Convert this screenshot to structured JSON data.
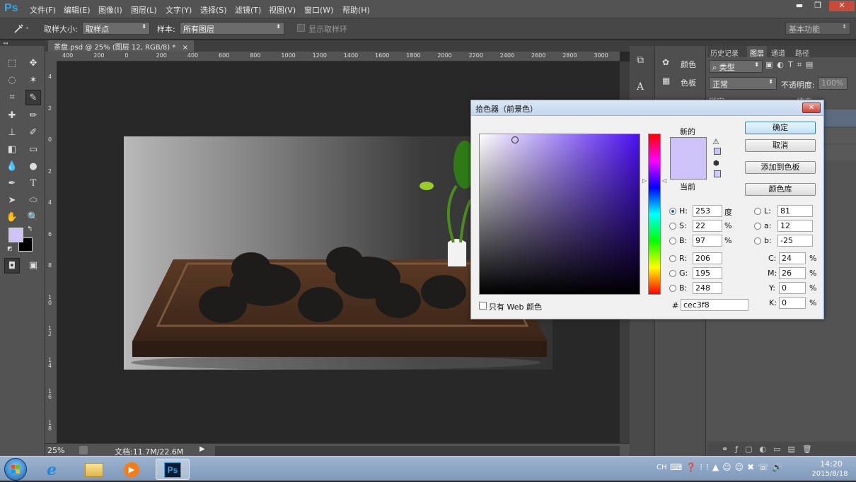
{
  "app": {
    "logo": "Ps"
  },
  "menubar": {
    "items": [
      "文件(F)",
      "编辑(E)",
      "图像(I)",
      "图层(L)",
      "文字(Y)",
      "选择(S)",
      "滤镜(T)",
      "视图(V)",
      "窗口(W)",
      "帮助(H)"
    ],
    "win_minimize": "▬",
    "win_restore": "❐",
    "win_close": "✕"
  },
  "options": {
    "sample_size_label": "取样大小:",
    "sample_size_value": "取样点",
    "sample_label": "样本:",
    "sample_value": "所有图层",
    "show_ring_label": "显示取样环",
    "workspace": "基本功能"
  },
  "document": {
    "tab_title": "茶盘.psd @ 25% (图层 12, RGB/8) *",
    "tab_close": "×",
    "ruler_h": [
      "400",
      "200",
      "0",
      "200",
      "400",
      "600",
      "800",
      "1000",
      "1200",
      "1400",
      "1600",
      "1800",
      "2000",
      "2200",
      "2400",
      "2600",
      "2800",
      "3000"
    ],
    "ruler_v": [
      "4",
      "2",
      "0",
      "2",
      "4",
      "6",
      "8",
      "1 0",
      "1 2",
      "1 4",
      "1 6",
      "1 8"
    ],
    "zoom": "25%",
    "doc_info": "文档:11.7M/22.6M"
  },
  "right_panel": {
    "mini_labels": {
      "color": "颜色",
      "swatches": "色板"
    },
    "tabs": [
      "历史记录",
      "图层",
      "通道",
      "路径"
    ],
    "filter_kind": "类型",
    "blend_mode": "正常",
    "opacity_label": "不透明度:",
    "opacity_value": "100%",
    "lock_label": "锁定:",
    "fill_label": "填充:"
  },
  "color_picker": {
    "title": "拾色器（前景色）",
    "close": "✕",
    "new_label": "新的",
    "current_label": "当前",
    "ok": "确定",
    "cancel": "取消",
    "add_to_swatches": "添加到色板",
    "color_libraries": "颜色库",
    "only_web": "只有 Web 颜色",
    "new_color": "#cec3f8",
    "current_color": "#cec3f8",
    "hsb": {
      "H": "253",
      "S": "22",
      "B": "97"
    },
    "hsb_units": {
      "H": "度",
      "S": "%",
      "B": "%"
    },
    "rgb": {
      "R": "206",
      "G": "195",
      "B": "248"
    },
    "lab": {
      "L": "81",
      "a": "12",
      "b": "-25"
    },
    "cmyk": {
      "C": "24",
      "M": "26",
      "Y": "0",
      "K": "0"
    },
    "percent": "%",
    "hex_label": "#",
    "hex": "cec3f8",
    "hue_level": 0.3
  },
  "taskbar": {
    "time": "14:20",
    "date": "2015/8/18",
    "lang": "CH"
  }
}
